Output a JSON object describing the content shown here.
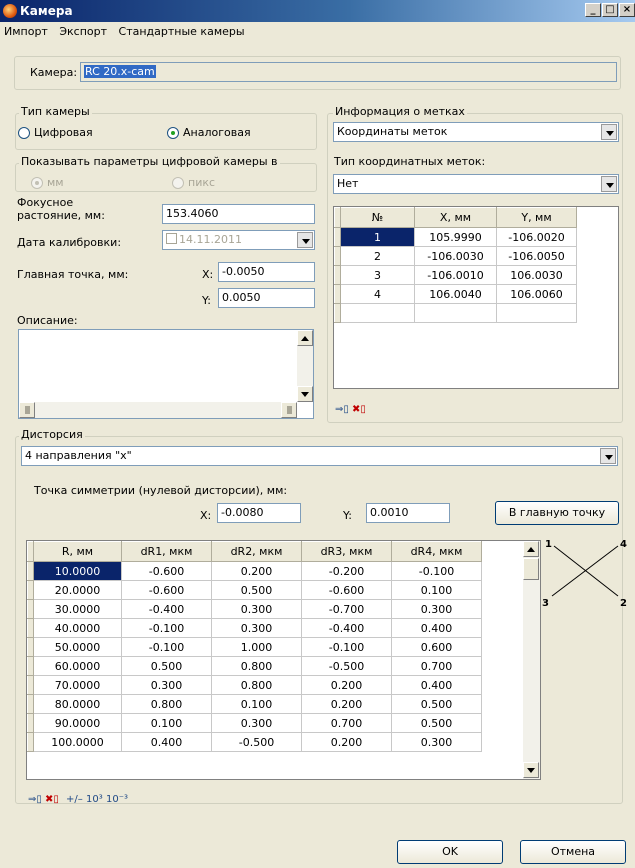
{
  "window": {
    "title": "Камера",
    "controls": [
      "_",
      "□",
      "×"
    ]
  },
  "menu": [
    "Импорт",
    "Экспорт",
    "Стандартные камеры"
  ],
  "camera": {
    "label": "Камера:",
    "value": "RC 20.x-cam"
  },
  "camera_type": {
    "title": "Тип камеры",
    "digital": "Цифровая",
    "analog": "Аналоговая",
    "selected": "Аналоговая"
  },
  "digital_params": {
    "title": "Показывать параметры цифровой камеры в",
    "mm": "мм",
    "px": "пикс",
    "selected": "мм"
  },
  "focal": {
    "label_line1": "Фокусное",
    "label_line2": "растояние, мм:",
    "value": "153.4060"
  },
  "calibration": {
    "label": "Дата калибровки:",
    "value": "14.11.2011"
  },
  "principal_point": {
    "label": "Главная точка, мм:",
    "x_label": "X:",
    "x": "-0.0050",
    "y_label": "Y:",
    "y": "0.0050"
  },
  "description": {
    "label": "Описание:"
  },
  "marks": {
    "title": "Информация о метках",
    "coords_option": "Координаты меток",
    "type_label": "Тип координатных меток:",
    "type_value": "Нет",
    "headers": [
      "№",
      "X, мм",
      "Y, мм"
    ],
    "rows": [
      [
        "1",
        "105.9990",
        "-106.0020"
      ],
      [
        "2",
        "-106.0030",
        "-106.0050"
      ],
      [
        "3",
        "-106.0010",
        "106.0030"
      ],
      [
        "4",
        "106.0040",
        "106.0060"
      ],
      [
        "",
        "",
        ""
      ]
    ]
  },
  "distortion": {
    "title": "Дисторсия",
    "mode": "4 направления \"х\"",
    "sym_label": "Точка симметрии (нулевой дисторсии), мм:",
    "x_label": "X:",
    "x": "-0.0080",
    "y_label": "Y:",
    "y": "0.0010",
    "to_principal": "В главную точку",
    "headers": [
      "R, мм",
      "dR1, мкм",
      "dR2, мкм",
      "dR3, мкм",
      "dR4, мкм"
    ],
    "rows": [
      [
        "10.0000",
        "-0.600",
        "0.200",
        "-0.200",
        "-0.100"
      ],
      [
        "20.0000",
        "-0.600",
        "0.500",
        "-0.600",
        "0.100"
      ],
      [
        "30.0000",
        "-0.400",
        "0.300",
        "-0.700",
        "0.300"
      ],
      [
        "40.0000",
        "-0.100",
        "0.300",
        "-0.400",
        "0.400"
      ],
      [
        "50.0000",
        "-0.100",
        "1.000",
        "-0.100",
        "0.600"
      ],
      [
        "60.0000",
        "0.500",
        "0.800",
        "-0.500",
        "0.700"
      ],
      [
        "70.0000",
        "0.300",
        "0.800",
        "0.200",
        "0.400"
      ],
      [
        "80.0000",
        "0.800",
        "0.100",
        "0.200",
        "0.500"
      ],
      [
        "90.0000",
        "0.100",
        "0.300",
        "0.700",
        "0.500"
      ],
      [
        "100.0000",
        "0.400",
        "-0.500",
        "0.200",
        "0.300"
      ]
    ],
    "diagram_labels": [
      "1",
      "4",
      "3",
      "2"
    ],
    "tools": [
      "+/–",
      "10³",
      "10⁻³"
    ]
  },
  "buttons": {
    "ok": "OK",
    "cancel": "Отмена"
  }
}
